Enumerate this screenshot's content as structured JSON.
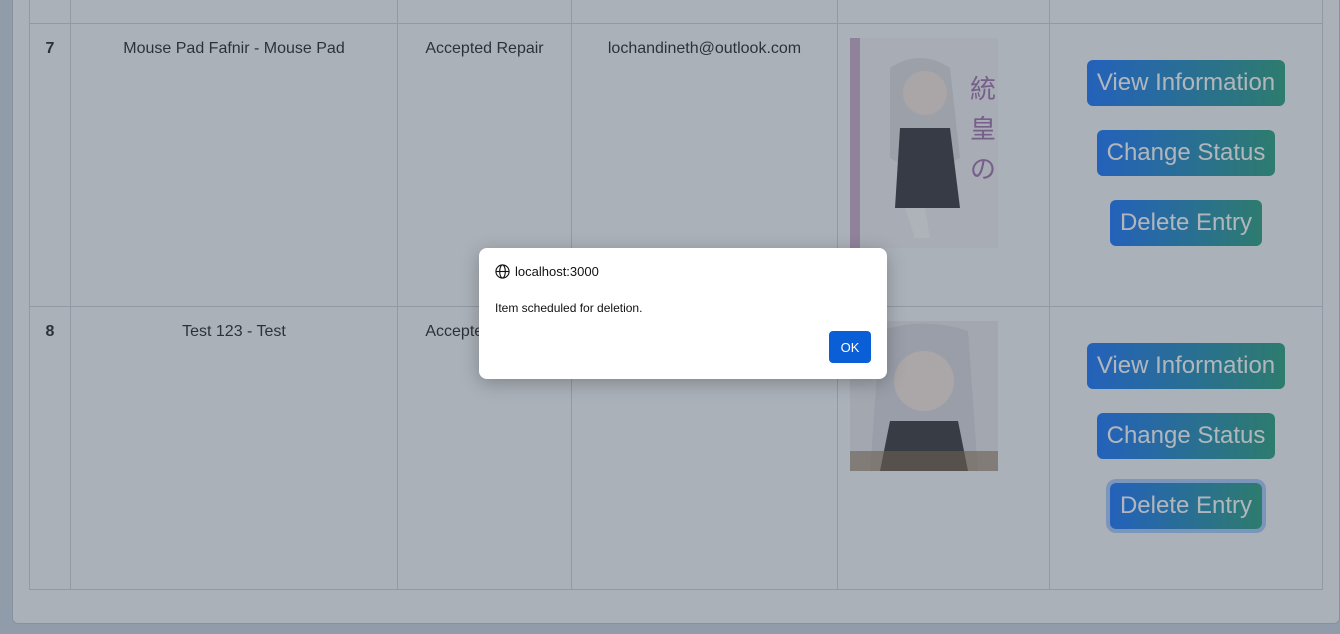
{
  "rows": [
    {
      "id": "7",
      "name": "Mouse Pad Fafnir - Mouse Pad",
      "status": "Accepted Repair",
      "email": "lochandineth@outlook.com",
      "image_alt": "Light novel cover art"
    },
    {
      "id": "8",
      "name": "Test 123 - Test",
      "status": "Accepted Repair",
      "email": "",
      "image_alt": "Anime girl illustration"
    }
  ],
  "actions": {
    "view_label": "View Information",
    "change_label": "Change Status",
    "delete_label": "Delete Entry"
  },
  "dialog": {
    "origin": "localhost:3000",
    "message": "Item scheduled for deletion.",
    "ok_label": "OK"
  },
  "colors": {
    "button_gradient_start": "#0d6efd",
    "button_gradient_end": "#1e9a7a",
    "ok_button": "#0b5fd6"
  }
}
